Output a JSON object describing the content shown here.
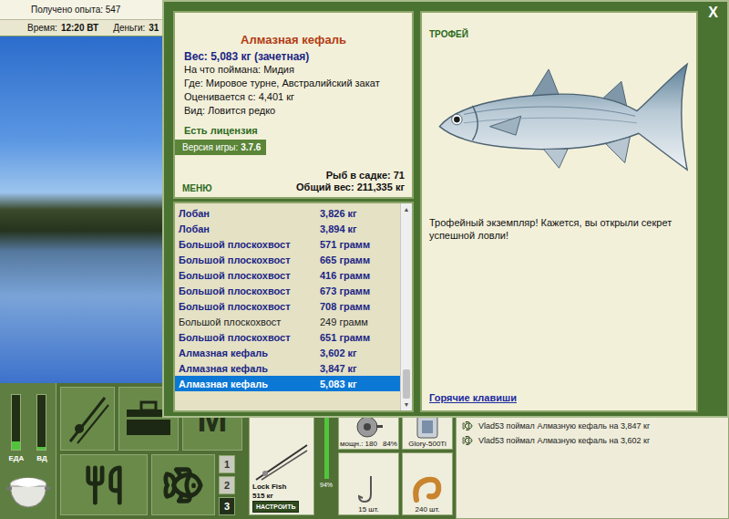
{
  "header": {
    "experience": "Получено опыта: 547",
    "time_label": "Время:",
    "time": "12:20 ВТ",
    "money_label": "Деньги:",
    "money": "31"
  },
  "meters": [
    {
      "label": "ЕДА",
      "level": 0.15
    },
    {
      "label": "ВД",
      "level": 0.05
    }
  ],
  "map_button": {
    "glyph": "M"
  },
  "slot_tabs": [
    {
      "label": "1",
      "selected": false
    },
    {
      "label": "2",
      "selected": false
    },
    {
      "label": "3",
      "selected": true
    }
  ],
  "tackle": {
    "rod": {
      "name": "Lock Fish",
      "capacity": "515 кг",
      "button": "НАСТРОИТЬ",
      "wear": "94%",
      "level": 0.94
    },
    "reel": {
      "power": "мощн.: 180",
      "wear": "84%"
    },
    "line": {
      "name": "Glory-500Ti"
    },
    "hook": {
      "count": "15 шт."
    },
    "bait": {
      "count": "240 шт."
    }
  },
  "log": [
    "Vlad53 поймал Алмазную кефаль на 3,847 кг",
    "Vlad53 поймал Алмазную кефаль на 3,602 кг"
  ],
  "dialog": {
    "close": "X",
    "fish": {
      "title": "Алмазная кефаль",
      "weight": "Вес: 5,083 кг (зачетная)",
      "details": [
        "На что поймана: Мидия",
        "Где: Мировое турне, Австралийский закат",
        "Оценивается с: 4,401 кг",
        "Вид: Ловится редко"
      ]
    },
    "license": "Есть лицензия",
    "version_label": "Версия игры:",
    "version": "3.7.6",
    "menu": "МЕНЮ",
    "keep_count": "Рыб в садке: 71",
    "total_weight": "Общий вес: 211,335 кг",
    "catches": [
      {
        "name": "Лобан",
        "weight": "3,826 кг",
        "emphasized": true,
        "selected": false
      },
      {
        "name": "Лобан",
        "weight": "3,894 кг",
        "emphasized": true,
        "selected": false
      },
      {
        "name": "Большой плоскохвост",
        "weight": "571 грамм",
        "emphasized": true,
        "selected": false
      },
      {
        "name": "Большой плоскохвост",
        "weight": "665 грамм",
        "emphasized": true,
        "selected": false
      },
      {
        "name": "Большой плоскохвост",
        "weight": "416 грамм",
        "emphasized": true,
        "selected": false
      },
      {
        "name": "Большой плоскохвост",
        "weight": "673 грамм",
        "emphasized": true,
        "selected": false
      },
      {
        "name": "Большой плоскохвост",
        "weight": "708 грамм",
        "emphasized": true,
        "selected": false
      },
      {
        "name": "Большой плоскохвост",
        "weight": "249 грамм",
        "emphasized": false,
        "selected": false
      },
      {
        "name": "Большой плоскохвост",
        "weight": "651 грамм",
        "emphasized": true,
        "selected": false
      },
      {
        "name": "Алмазная кефаль",
        "weight": "3,602 кг",
        "emphasized": true,
        "selected": false
      },
      {
        "name": "Алмазная кефаль",
        "weight": "3,847 кг",
        "emphasized": true,
        "selected": false
      },
      {
        "name": "Алмазная кефаль",
        "weight": "5,083 кг",
        "emphasized": true,
        "selected": true
      }
    ],
    "scroll": {
      "level": 1,
      "up": "▲",
      "down": "▼"
    },
    "trophy": {
      "label": "ТРОФЕЙ",
      "text": "Трофейный экземпляр! Кажется, вы открыли секрет успешной ловли!",
      "link": "Горячие клавиши"
    }
  }
}
